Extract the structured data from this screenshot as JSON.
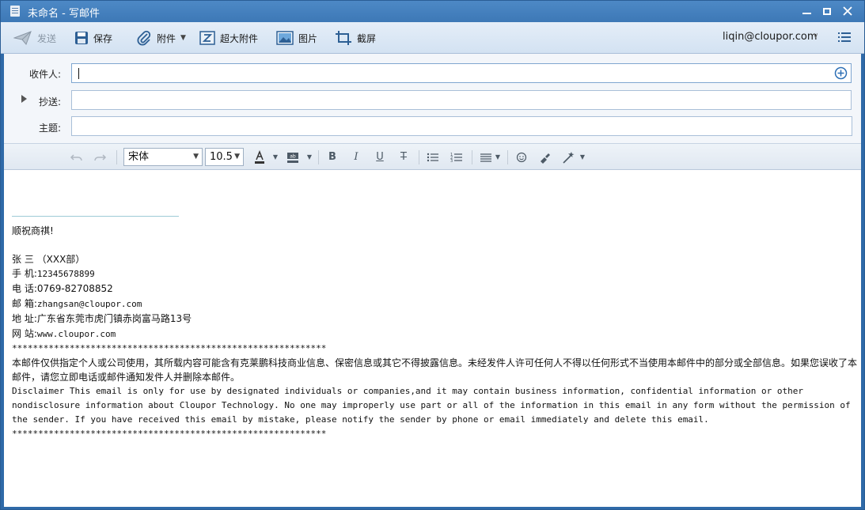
{
  "window": {
    "title": "未命名 - 写邮件"
  },
  "toolbar": {
    "send_label": "发送",
    "save_label": "保存",
    "attach_label": "附件",
    "big_attach_label": "超大附件",
    "picture_label": "图片",
    "screenshot_label": "截屏",
    "account": "liqin@cloupor.com"
  },
  "fields": {
    "to_label": "收件人:",
    "cc_label": "抄送:",
    "subject_label": "主题:",
    "to_value": "",
    "cc_value": "",
    "subject_value": ""
  },
  "format": {
    "font": "宋体",
    "size": "10.5"
  },
  "signature": {
    "greeting": "顺祝商祺!",
    "name": "张 三 （XXX部）",
    "mobile_label": "手 机:",
    "mobile": "12345678899",
    "phone_label": "电 话:",
    "phone": "0769-82708852",
    "email_label": "邮 箱:",
    "email": "zhangsan@cloupor.com",
    "address_label": "地 址:",
    "address": "广东省东莞市虎门镇赤岗富马路13号",
    "website_label": "网 站:",
    "website": "www.cloupor.com",
    "stars": "************************************************************",
    "disclaimer_cn": "本邮件仅供指定个人或公司使用，其所载内容可能含有克莱鹏科技商业信息、保密信息或其它不得披露信息。未经发件人许可任何人不得以任何形式不当使用本邮件中的部分或全部信息。如果您误收了本邮件，请您立即电话或邮件通知发件人并删除本邮件。",
    "disclaimer_en": "Disclaimer This email is only for use by designated individuals or companies,and it may contain business information, confidential information or other nondisclosure information about Cloupor Technology. No one may improperly use part or all of the information in this email in any form without the permission of the sender. If you have received this email by mistake, please notify the sender by phone or email immediately and delete this email."
  },
  "colors": {
    "titlebar": "#3d78b6",
    "accent": "#2f6aa8"
  }
}
